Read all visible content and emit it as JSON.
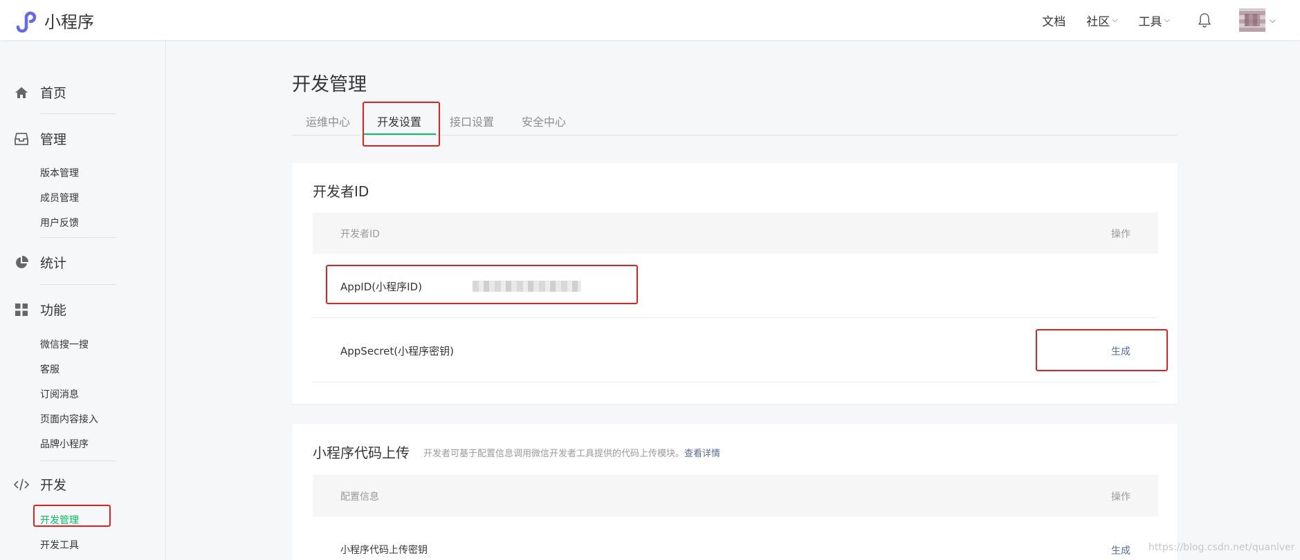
{
  "app": {
    "name": "小程序"
  },
  "topnav": {
    "items": [
      {
        "label": "文档",
        "has_dropdown": false
      },
      {
        "label": "社区",
        "has_dropdown": true
      },
      {
        "label": "工具",
        "has_dropdown": true
      }
    ],
    "bell_icon": "bell-icon",
    "avatar_icon": "avatar"
  },
  "sidebar": {
    "home": {
      "label": "首页",
      "icon": "home-icon"
    },
    "manage": {
      "label": "管理",
      "icon": "inbox-icon",
      "items": [
        "版本管理",
        "成员管理",
        "用户反馈"
      ]
    },
    "stats": {
      "label": "统计",
      "icon": "pie-chart-icon"
    },
    "features": {
      "label": "功能",
      "icon": "grid-icon",
      "items": [
        "微信搜一搜",
        "客服",
        "订阅消息",
        "页面内容接入",
        "品牌小程序"
      ]
    },
    "dev": {
      "label": "开发",
      "icon": "code-icon",
      "items": [
        "开发管理",
        "开发工具"
      ],
      "active_item": "开发管理"
    }
  },
  "main": {
    "title": "开发管理",
    "tabs": [
      "运维中心",
      "开发设置",
      "接口设置",
      "安全中心"
    ],
    "active_tab": "开发设置",
    "developer_id_card": {
      "title": "开发者ID",
      "header": {
        "col1": "开发者ID",
        "col2": "操作"
      },
      "rows": [
        {
          "name": "AppID(小程序ID)",
          "value_redacted": true,
          "action": ""
        },
        {
          "name": "AppSecret(小程序密钥)",
          "action": "生成"
        }
      ]
    },
    "upload_card": {
      "title": "小程序代码上传",
      "subtitle": "开发者可基于配置信息调用微信开发者工具提供的代码上传模块。",
      "subtitle_link": "查看详情",
      "header": {
        "col1": "配置信息",
        "col2": "操作"
      },
      "rows": [
        {
          "name": "小程序代码上传密钥",
          "action": "生成"
        }
      ]
    }
  },
  "watermark": "https://blog.csdn.net/quanlver",
  "colors": {
    "accent_green": "#07c160",
    "link_blue": "#576b95",
    "highlight_red": "#e02020",
    "logo_purple": "#6467f0"
  }
}
